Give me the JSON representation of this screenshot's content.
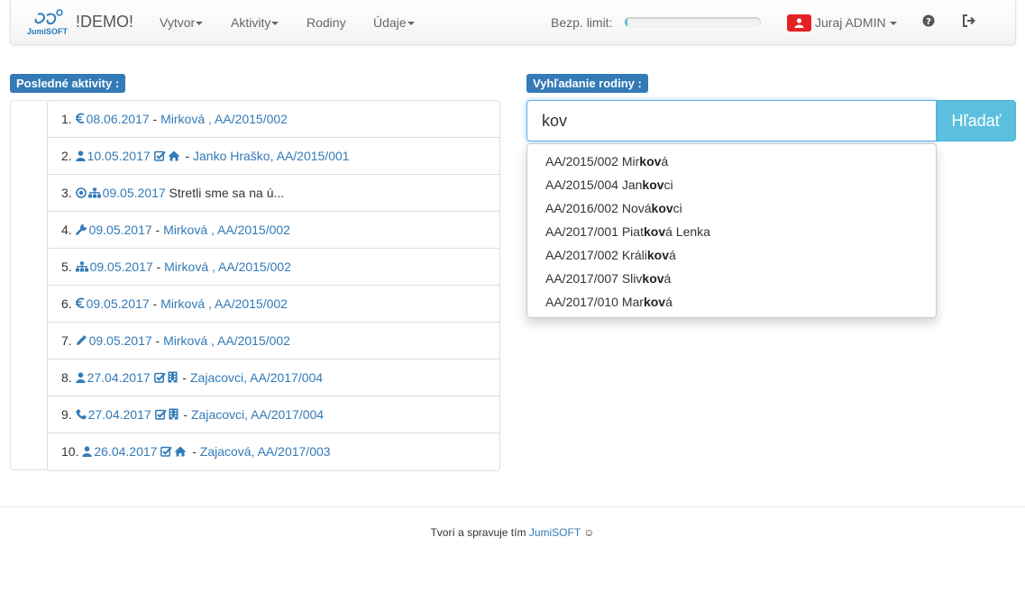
{
  "navbar": {
    "logo_text": "JumiSOFT",
    "brand": "!DEMO!",
    "menu": [
      {
        "label": "Vytvor",
        "dropdown": true
      },
      {
        "label": "Aktivity",
        "dropdown": true
      },
      {
        "label": "Rodiny",
        "dropdown": false
      },
      {
        "label": "Údaje",
        "dropdown": true
      }
    ],
    "limit_label": "Bezp. limit:",
    "limit_fraction": 0.02,
    "user_name": "Juraj ADMIN",
    "help_icon": "question-circle-icon",
    "logout_icon": "sign-out-icon"
  },
  "activities": {
    "title": "Posledné aktivity :",
    "rows": [
      {
        "num": "1.",
        "icons": [
          "euro-icon"
        ],
        "date": "08.06.2017",
        "after_icons": [],
        "sep": " - ",
        "text": "Mirková , AA/2015/002",
        "text_link": true
      },
      {
        "num": "2.",
        "icons": [
          "user-icon"
        ],
        "date": "10.05.2017",
        "after_icons": [
          "check-square-icon",
          "home-icon"
        ],
        "sep": " - ",
        "text": "Janko Hraško, AA/2015/001",
        "text_link": true
      },
      {
        "num": "3.",
        "icons": [
          "dot-circle-icon",
          "sitemap-icon"
        ],
        "date": "09.05.2017",
        "after_icons": [],
        "sep": " ",
        "text": "Stretli sme sa na ú...",
        "text_link": false
      },
      {
        "num": "4.",
        "icons": [
          "wrench-icon"
        ],
        "date": "09.05.2017",
        "after_icons": [],
        "sep": " - ",
        "text": "Mirková , AA/2015/002",
        "text_link": true
      },
      {
        "num": "5.",
        "icons": [
          "sitemap-icon"
        ],
        "date": "09.05.2017",
        "after_icons": [],
        "sep": " - ",
        "text": "Mirková , AA/2015/002",
        "text_link": true
      },
      {
        "num": "6.",
        "icons": [
          "euro-icon"
        ],
        "date": "09.05.2017",
        "after_icons": [],
        "sep": " - ",
        "text": "Mirková , AA/2015/002",
        "text_link": true
      },
      {
        "num": "7.",
        "icons": [
          "pencil-icon"
        ],
        "date": "09.05.2017",
        "after_icons": [],
        "sep": " - ",
        "text": "Mirková , AA/2015/002",
        "text_link": true
      },
      {
        "num": "8.",
        "icons": [
          "user-icon"
        ],
        "date": "27.04.2017",
        "after_icons": [
          "check-square-icon",
          "building-icon"
        ],
        "sep": " - ",
        "text": "Zajacovci, AA/2017/004",
        "text_link": true
      },
      {
        "num": "9.",
        "icons": [
          "phone-icon"
        ],
        "date": "27.04.2017",
        "after_icons": [
          "check-square-icon",
          "building-icon"
        ],
        "sep": " - ",
        "text": "Zajacovci, AA/2017/004",
        "text_link": true
      },
      {
        "num": "10.",
        "icons": [
          "user-icon"
        ],
        "date": "26.04.2017",
        "after_icons": [
          "check-square-icon",
          "home-icon"
        ],
        "sep": " - ",
        "text": "Zajacová, AA/2017/003",
        "text_link": true
      }
    ]
  },
  "search": {
    "title": "Vyhľadanie rodiny :",
    "value": "kov",
    "button_label": "Hľadať",
    "suggestions": [
      {
        "pre": "AA/2015/002 Mir",
        "match": "kov",
        "post": "á"
      },
      {
        "pre": "AA/2015/004 Jan",
        "match": "kov",
        "post": "ci"
      },
      {
        "pre": "AA/2016/002 Nová",
        "match": "kov",
        "post": "ci"
      },
      {
        "pre": "AA/2017/001 Piat",
        "match": "kov",
        "post": "á Lenka"
      },
      {
        "pre": "AA/2017/002 Králi",
        "match": "kov",
        "post": "á"
      },
      {
        "pre": "AA/2017/007 Sliv",
        "match": "kov",
        "post": "á"
      },
      {
        "pre": "AA/2017/010 Mar",
        "match": "kov",
        "post": "á"
      }
    ]
  },
  "footer": {
    "text": "Tvorí a spravuje tím ",
    "link": "JumiSOFT",
    "smiley": "☺"
  },
  "colors": {
    "primary": "#337ab7",
    "info": "#5bc0de",
    "user_badge": "#e52222"
  }
}
